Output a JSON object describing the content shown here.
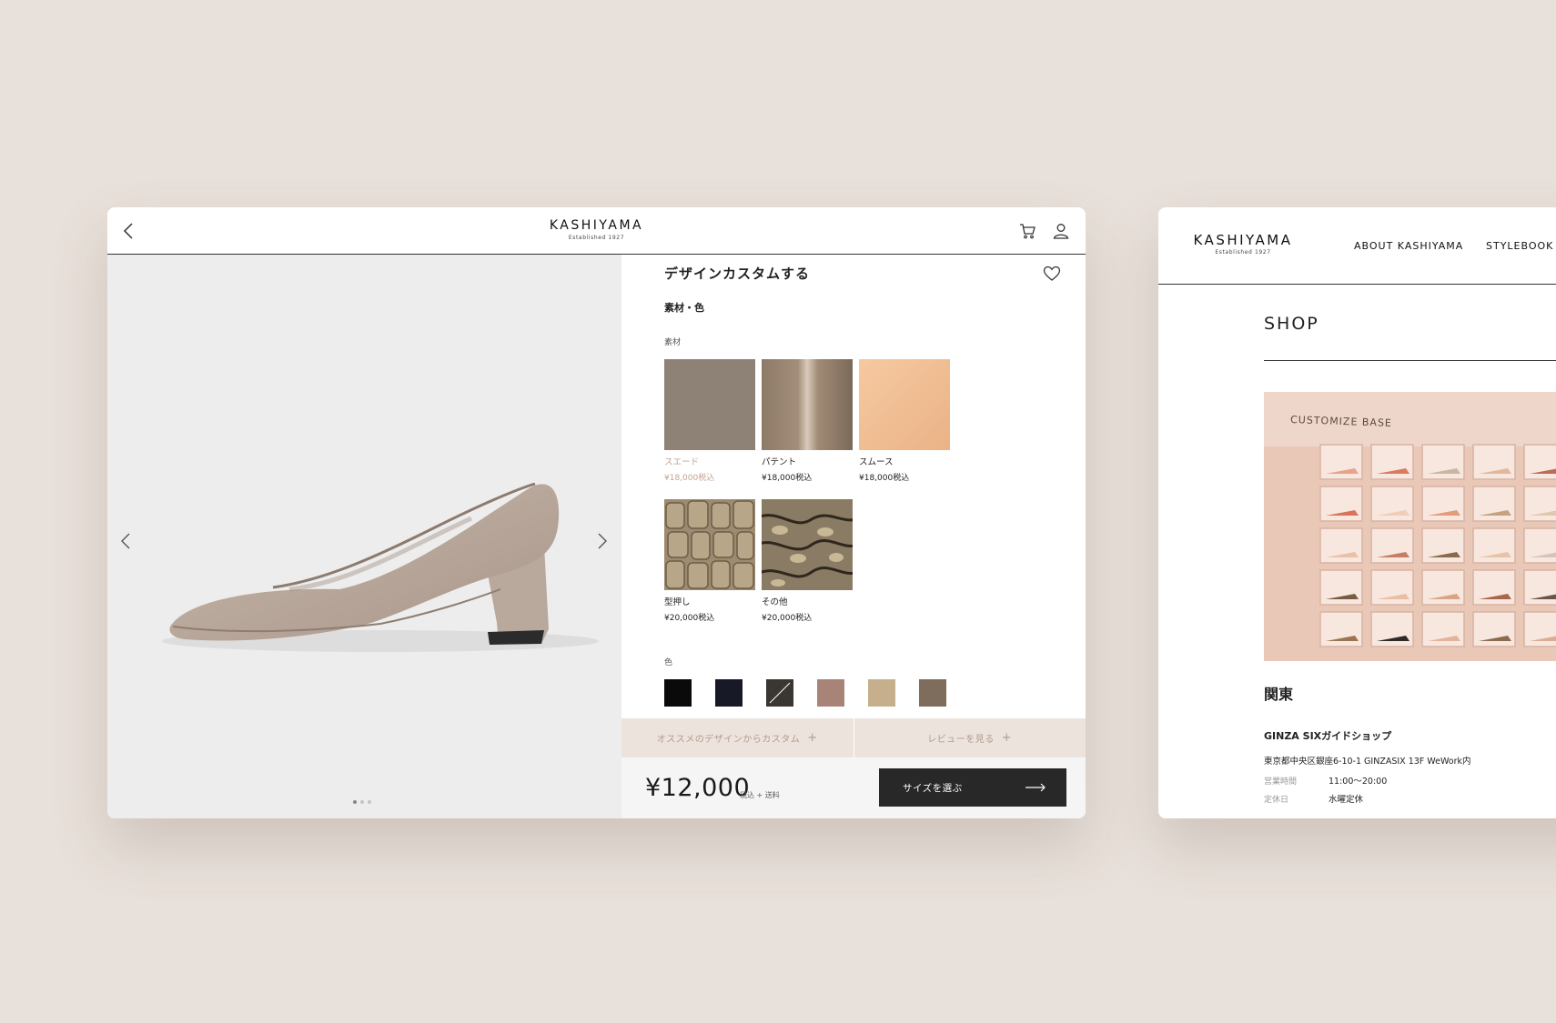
{
  "product_page": {
    "header": {
      "logo_name": "KASHIYAMA",
      "logo_sub": "Established 1927",
      "icons": [
        "back-icon",
        "cart-icon",
        "user-icon"
      ]
    },
    "gallery": {
      "slide_count": 3,
      "active_slide": 1
    },
    "title": "デザインカスタムする",
    "section_title": "素材・色",
    "materials_label": "素材",
    "materials": [
      {
        "name": "スエード",
        "price": "¥18,000税込",
        "selected": true,
        "color": "#8a7d71"
      },
      {
        "name": "パテント",
        "price": "¥18,000税込",
        "selected": false,
        "color": "#9a8470"
      },
      {
        "name": "スムース",
        "price": "¥18,000税込",
        "selected": false,
        "color": "#f2bf93"
      },
      {
        "name": "型押し",
        "price": "¥20,000税込",
        "selected": false,
        "color": "#9c8b70"
      },
      {
        "name": "その他",
        "price": "¥20,000税込",
        "selected": false,
        "color": "#6f5e4c"
      }
    ],
    "colors_label": "色",
    "colors": [
      "#0a0a0a",
      "#171a26",
      "#3a3632",
      "#a88478",
      "#c6af8c",
      "#7e6c5c"
    ],
    "tabs": [
      {
        "label": "オススメのデザインからカスタム"
      },
      {
        "label": "レビューを見る"
      }
    ],
    "price": "¥12,000",
    "price_note": "税込 + 送料",
    "size_button": "サイズを選ぶ"
  },
  "shop_page": {
    "logo_name": "KASHIYAMA",
    "logo_sub": "Established 1927",
    "nav": [
      "ABOUT KASHIYAMA",
      "STYLEBOOK"
    ],
    "title": "SHOP",
    "photo_sign": "CUSTOMIZE BASE",
    "region": "関東",
    "store": {
      "name": "GINZA SIXガイドショップ",
      "address": "東京都中央区銀座6-10-1 GINZASIX 13F WeWork内",
      "hours_label": "営業時間",
      "hours": "11:00〜20:00",
      "closed_label": "定休日",
      "closed": "水曜定休"
    }
  }
}
